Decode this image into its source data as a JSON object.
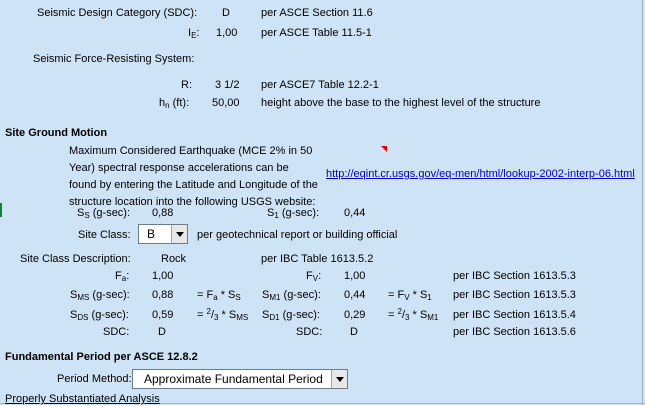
{
  "top": {
    "sdc_label": "Seismic Design Category (SDC):",
    "sdc_value": "D",
    "sdc_ref": "per ASCE Section 11.6",
    "ie_sym": "I",
    "ie_sub": "E",
    "ie_value": "1,00",
    "ie_ref": "per ASCE Table 11.5-1",
    "sfrs_label": "Seismic Force-Resisting System:",
    "r_label": "R:",
    "r_value": "3 1/2",
    "r_ref": "per ASCE7 Table 12.2-1",
    "hn_sym": "h",
    "hn_sub": "n",
    "hn_unit": "(ft):",
    "hn_value": "50,00",
    "hn_ref": "height above the base to the highest level of the structure"
  },
  "ground": {
    "title": "Site Ground Motion",
    "desc_lines": [
      "Maximum Considered Earthquake (MCE 2% in 50",
      "Year) spectral response accelerations can be",
      "found by entering the Latitude and Longitude of the",
      "structure location into the following USGS website:"
    ],
    "link": "http://eqint.cr.usgs.gov/eq-men/html/lookup-2002-interp-06.html",
    "ss_sym": "S",
    "ss_sub": "S",
    "ss_unit": "(g-sec):",
    "ss_value": "0,88",
    "s1_sym": "S",
    "s1_sub": "1",
    "s1_unit": "(g-sec):",
    "s1_value": "0,44",
    "site_class_label": "Site Class:",
    "site_class_value": "B",
    "site_class_ref": "per geotechnical report or building official",
    "scd_label": "Site Class Description:",
    "scd_value": "Rock",
    "scd_ref": "per IBC Table 1613.5.2",
    "fa_sym": "F",
    "fa_sub": "a",
    "fa_value": "1,00",
    "fv_sym": "F",
    "fv_sub": "V",
    "fv_value": "1,00",
    "fv_ref": "per IBC Section 1613.5.3",
    "sms_sub": "MS",
    "sms_value": "0,88",
    "sms_formula_a": "= F",
    "sms_formula_a_sub": "a",
    "sms_formula_b": " * S",
    "sms_formula_b_sub": "S",
    "sm1_sub": "M1",
    "sm1_value": "0,44",
    "sm1_formula_a": "= F",
    "sm1_formula_a_sub": "V",
    "sm1_formula_b": " * S",
    "sm1_formula_b_sub": "1",
    "sm1_ref": "per IBC Section 1613.5.3",
    "sds_sub": "DS",
    "sds_value": "0,59",
    "sds_formula_sup": "2",
    "sds_formula_sub": "3",
    "sds_formula_tail_sub": "MS",
    "sd1_sub": "D1",
    "sd1_value": "0,29",
    "sd1_formula_tail_sub": "M1",
    "sd1_ref": "per IBC Section 1613.5.4",
    "sdc1_label": "SDC:",
    "sdc1_value": "D",
    "sdc2_label": "SDC:",
    "sdc2_value": "D",
    "sdc_ref": "per IBC Section 1613.5.6",
    "g_unit": "(g-sec):",
    "formula_eq": "= ",
    "formula_slash": "/",
    "formula_star_s": " * S"
  },
  "period": {
    "title": "Fundamental Period per ASCE 12.8.2",
    "method_label": "Period Method:",
    "method_value": "Approximate Fundamental Period",
    "psa_label": "Properly Substantiated Analysis"
  }
}
